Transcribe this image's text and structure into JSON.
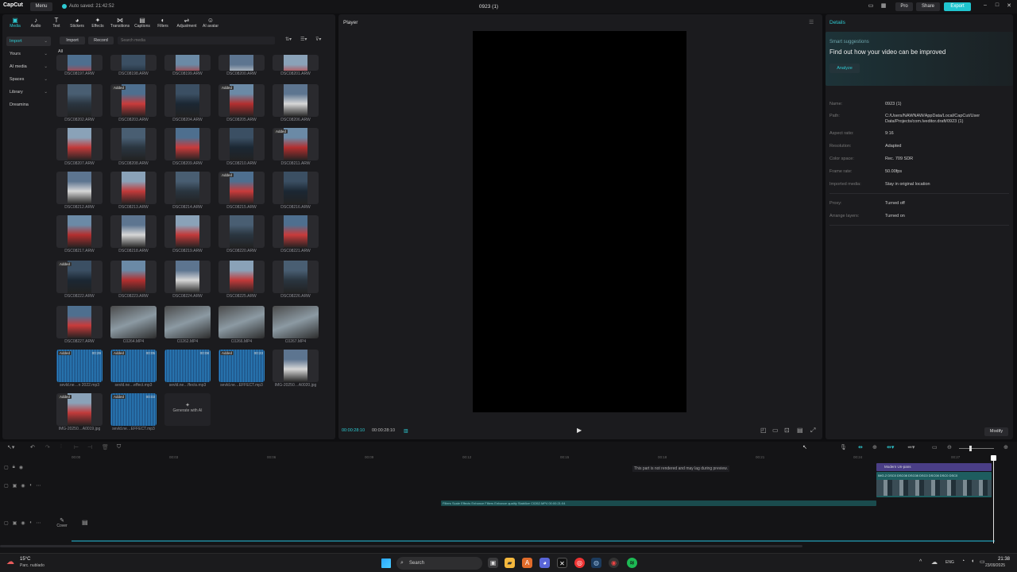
{
  "titlebar": {
    "logo": "CapCut",
    "menu_label": "Menu",
    "autosave": "Auto saved: 21:42:52",
    "window_title": "0923 (1)",
    "pro_label": "Pro",
    "share_label": "Share",
    "export_label": "Export"
  },
  "toolbar_tabs": [
    {
      "label": "Media",
      "icon": "media-icon"
    },
    {
      "label": "Audio",
      "icon": "audio-icon"
    },
    {
      "label": "Text",
      "icon": "text-icon"
    },
    {
      "label": "Stickers",
      "icon": "stickers-icon"
    },
    {
      "label": "Effects",
      "icon": "effects-icon"
    },
    {
      "label": "Transitions",
      "icon": "transitions-icon"
    },
    {
      "label": "Captions",
      "icon": "captions-icon"
    },
    {
      "label": "Filters",
      "icon": "filters-icon"
    },
    {
      "label": "Adjustment",
      "icon": "adjustment-icon"
    },
    {
      "label": "AI avatar",
      "icon": "ai-avatar-icon"
    }
  ],
  "sidebar": {
    "items": [
      "Import",
      "Yours",
      "AI media",
      "Spaces",
      "Library",
      "Dreamina"
    ]
  },
  "media": {
    "import_label": "Import",
    "record_label": "Record",
    "search_placeholder": "Search media",
    "all_label": "All",
    "rows": [
      [
        {
          "name": "DSC08197.ARW",
          "added": false
        },
        {
          "name": "DSC08198.ARW",
          "added": false
        },
        {
          "name": "DSC08199.ARW",
          "added": false
        },
        {
          "name": "DSC08200.ARW",
          "added": false
        },
        {
          "name": "DSC08201.ARW",
          "added": false
        }
      ],
      [
        {
          "name": "DSC08202.ARW",
          "added": false
        },
        {
          "name": "DSC08203.ARW",
          "added": true
        },
        {
          "name": "DSC08204.ARW",
          "added": false
        },
        {
          "name": "DSC08205.ARW",
          "added": true
        },
        {
          "name": "DSC08206.ARW",
          "added": false
        }
      ],
      [
        {
          "name": "DSC08207.ARW",
          "added": false
        },
        {
          "name": "DSC08208.ARW",
          "added": false
        },
        {
          "name": "DSC08209.ARW",
          "added": false
        },
        {
          "name": "DSC08210.ARW",
          "added": false
        },
        {
          "name": "DSC08211.ARW",
          "added": true
        }
      ],
      [
        {
          "name": "DSC08212.ARW",
          "added": false
        },
        {
          "name": "DSC08213.ARW",
          "added": false
        },
        {
          "name": "DSC08214.ARW",
          "added": false
        },
        {
          "name": "DSC08215.ARW",
          "added": true
        },
        {
          "name": "DSC08216.ARW",
          "added": false
        }
      ],
      [
        {
          "name": "DSC08217.ARW",
          "added": false
        },
        {
          "name": "DSC08218.ARW",
          "added": false
        },
        {
          "name": "DSC08219.ARW",
          "added": false
        },
        {
          "name": "DSC08220.ARW",
          "added": false
        },
        {
          "name": "DSC08221.ARW",
          "added": false
        }
      ],
      [
        {
          "name": "DSC08222.ARW",
          "added": true
        },
        {
          "name": "DSC08223.ARW",
          "added": false
        },
        {
          "name": "DSC08224.ARW",
          "added": false
        },
        {
          "name": "DSC08225.ARW",
          "added": false
        },
        {
          "name": "DSC08226.ARW",
          "added": false
        }
      ],
      [
        {
          "name": "DSC08227.ARW",
          "added": false
        },
        {
          "name": "C0264.MP4",
          "added": false,
          "wide": true
        },
        {
          "name": "C0262.MP4",
          "added": false,
          "wide": true
        },
        {
          "name": "C0266.MP4",
          "added": false,
          "wide": true
        },
        {
          "name": "C0267.MP4",
          "added": false,
          "wide": true
        }
      ],
      [
        {
          "name": "sevld.ne…n 2022.mp3",
          "added": true,
          "audio": true,
          "duration": "00:29"
        },
        {
          "name": "sevld.ne…effect.mp3",
          "added": true,
          "audio": true,
          "duration": "00:05"
        },
        {
          "name": "sevld.ne…ffects.mp3",
          "added": false,
          "audio": true,
          "duration": "00:08"
        },
        {
          "name": "sevld.ne…EFFECT.mp3",
          "added": true,
          "audio": true,
          "duration": "00:23"
        },
        {
          "name": "IMG-20250…A0020.jpg",
          "added": false
        }
      ],
      [
        {
          "name": "IMG-20250…A0019.jpg",
          "added": true
        },
        {
          "name": "sevld.ne…EFFECT.mp3",
          "added": true,
          "audio": true,
          "duration": "00:03"
        }
      ]
    ],
    "generate_label": "Generate with AI"
  },
  "player": {
    "title": "Player",
    "timecode": "00:00:28:10",
    "timecode_total": "00:00:28:10"
  },
  "details": {
    "title": "Details",
    "suggest_label": "Smart suggestions",
    "suggest_title": "Find out how your video can be improved",
    "analyze_label": "Analyze",
    "rows": [
      {
        "k": "Name:",
        "v": "0923 (1)"
      },
      {
        "k": "Path:",
        "v": "C:/Users/NAWNAW/AppData/Local/CapCut/User Data/Projects/com.lveditor.draft/0923 (1)"
      },
      {
        "k": "Aspect ratio:",
        "v": "9:16"
      },
      {
        "k": "Resolution:",
        "v": "Adapted"
      },
      {
        "k": "Color space:",
        "v": "Rec. 709 SDR"
      },
      {
        "k": "Frame rate:",
        "v": "50.00fps"
      },
      {
        "k": "Imported media:",
        "v": "Stay in original location"
      },
      {
        "k": "Proxy:",
        "v": "Turned off"
      },
      {
        "k": "Arrange layers:",
        "v": "Turned on"
      }
    ],
    "modify_label": "Modify"
  },
  "timeline": {
    "ticks": [
      "00:00",
      "00:03",
      "00:06",
      "00:09",
      "00:12",
      "00:15",
      "00:18",
      "00:21",
      "00:24",
      "00:27"
    ],
    "lag_note": "This part is not rendered and may lag during preview.",
    "clip_strip_label": "Modern Un-pans",
    "clip_labels": "IMG-2 DSC0 DSC08 DSC08 DSC0 DSC08 DSC0 DSC0",
    "fx_bar": "Filters  Scale  Effects  Enhance  Filters  Enhance quality  Stabilize  C0262.MP4  00:00:21:04",
    "cover_label": "Cover"
  },
  "taskbar": {
    "temp": "15°C",
    "condition": "Parc. nublado",
    "search_placeholder": "Search",
    "lang": "ENG",
    "time": "21:38",
    "date": "23/09/2025"
  }
}
